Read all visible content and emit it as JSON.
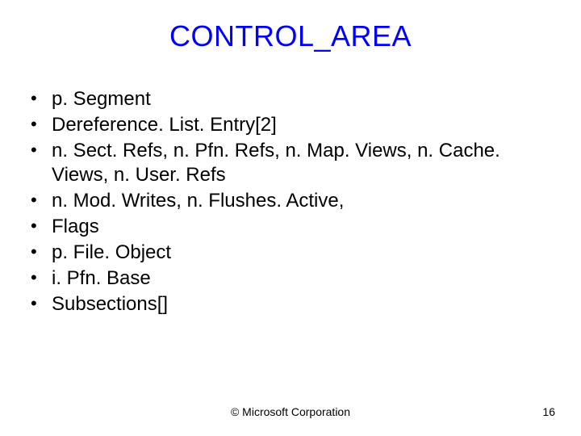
{
  "title": "CONTROL_AREA",
  "bullets": [
    "p. Segment",
    "Dereference. List. Entry[2]",
    "n. Sect. Refs, n. Pfn. Refs, n. Map. Views, n. Cache. Views, n. User. Refs",
    "n. Mod. Writes, n. Flushes. Active,",
    "Flags",
    "p. File. Object",
    "i. Pfn. Base",
    "Subsections[]"
  ],
  "footer": {
    "copyright": "© Microsoft Corporation",
    "page_number": "16"
  }
}
